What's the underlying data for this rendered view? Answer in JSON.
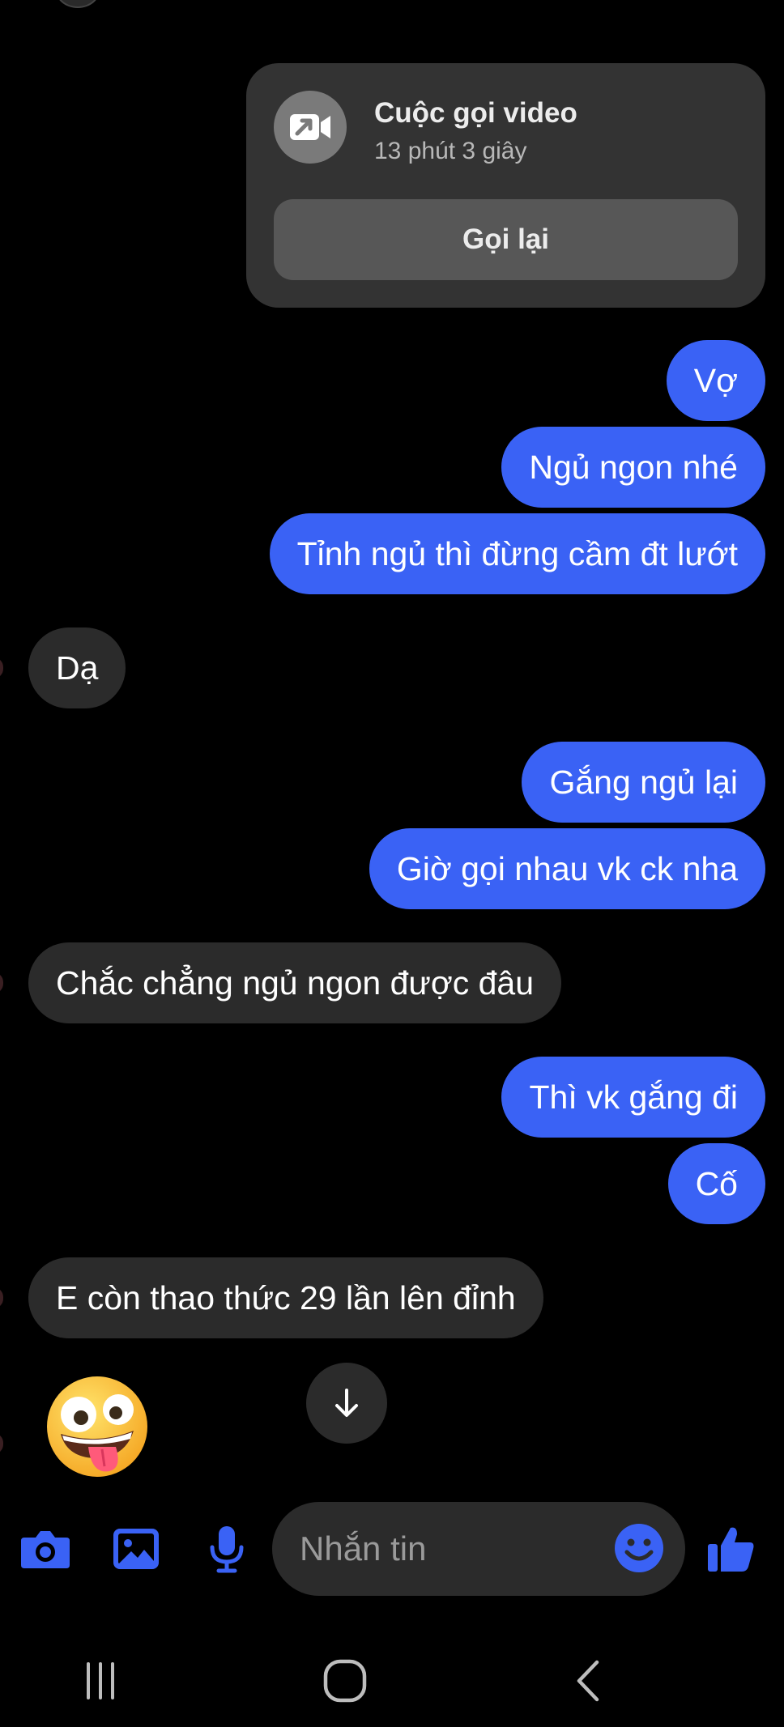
{
  "call_card": {
    "title": "Cuộc gọi video",
    "duration": "13 phút 3 giây",
    "callback_label": "Gọi lại",
    "icon": "video-call-icon"
  },
  "messages": [
    {
      "side": "out",
      "text": "Vợ"
    },
    {
      "side": "out",
      "text": "Ngủ ngon nhé"
    },
    {
      "side": "out",
      "text": "Tỉnh ngủ thì đừng cầm đt lướt"
    },
    {
      "side": "in",
      "text": "Dạ"
    },
    {
      "side": "out",
      "text": "Gắng ngủ lại"
    },
    {
      "side": "out",
      "text": "Giờ gọi nhau vk ck nha"
    },
    {
      "side": "in",
      "text": "Chắc chẳng ngủ ngon được đâu"
    },
    {
      "side": "out",
      "text": "Thì vk gắng đi"
    },
    {
      "side": "out",
      "text": "Cố"
    },
    {
      "side": "in",
      "text": "E còn thao thức 29 lần lên đỉnh"
    }
  ],
  "last_reaction": {
    "icon": "zany-face-emoji"
  },
  "composer": {
    "placeholder": "Nhắn tin",
    "icons": [
      "camera-icon",
      "gallery-icon",
      "microphone-icon",
      "emoji-icon",
      "thumbs-up-icon"
    ]
  },
  "nav_bar": {
    "icons": [
      "recent-apps-icon",
      "home-icon",
      "back-icon"
    ]
  },
  "colors": {
    "background": "#000000",
    "outgoing_bubble": "#3a62f5",
    "incoming_bubble": "#2b2b2b",
    "accent": "#3a62f5"
  }
}
